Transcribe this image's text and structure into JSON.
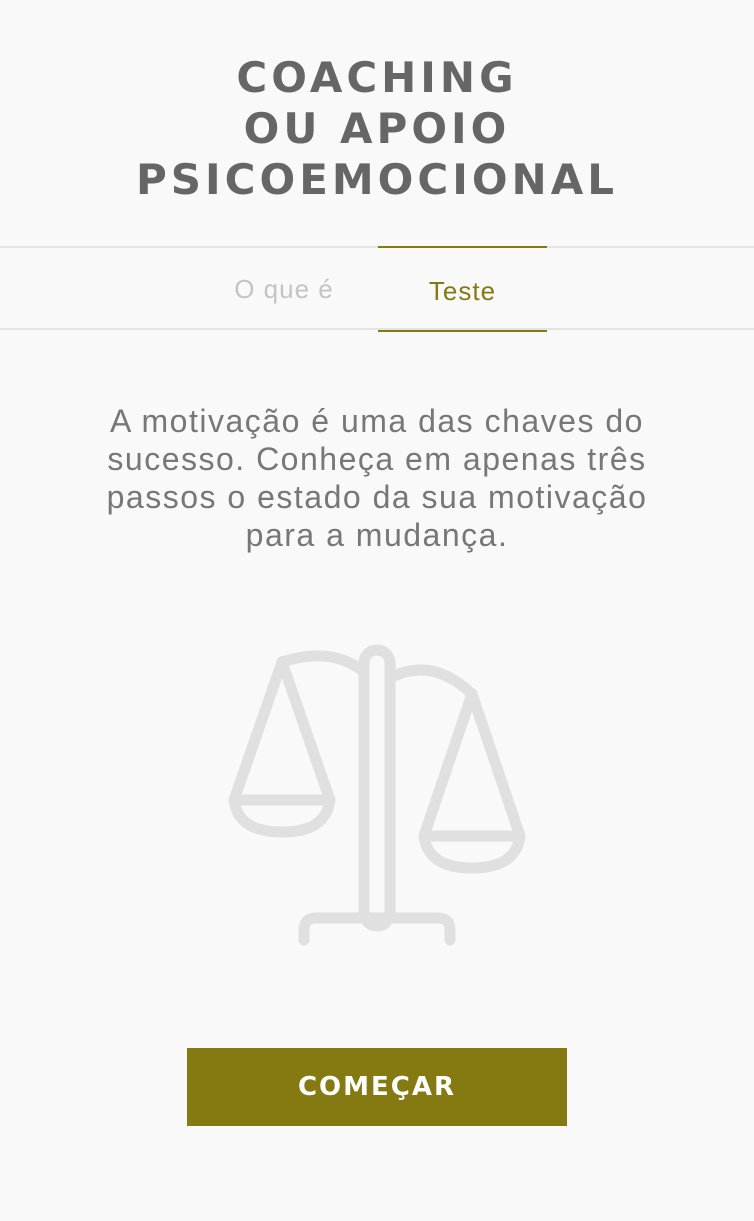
{
  "header": {
    "title_lines": [
      "COACHING",
      "OU APOIO",
      "PSICOEMOCIONAL"
    ]
  },
  "tabs": [
    {
      "label": "O que é",
      "active": false
    },
    {
      "label": "Teste",
      "active": true
    }
  ],
  "main": {
    "description": "A motivação é uma das chaves do sucesso. Conheça em apenas três passos o estado da sua motivação para a mudança.",
    "illustration_icon": "balance-scale-icon",
    "start_label": "COMEÇAR"
  },
  "colors": {
    "accent": "#857a12",
    "title": "#666666",
    "body_text": "#777777",
    "inactive_tab": "#c4c4c4",
    "icon": "#e0e0e0",
    "background": "#f9f9f9",
    "divider": "#e3e3e3"
  }
}
